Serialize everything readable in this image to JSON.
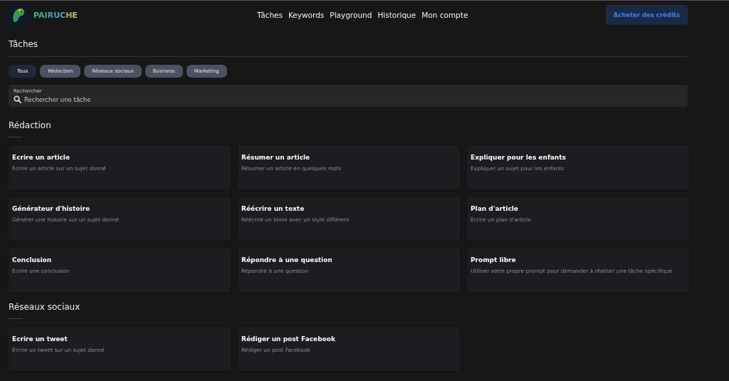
{
  "brand": "PAIRUCHE",
  "nav": [
    "Tâches",
    "Keywords",
    "Playground",
    "Historique",
    "Mon compte"
  ],
  "buy_button": "Acheter des crédits",
  "page_title": "Tâches",
  "filters": [
    {
      "label": "Tous",
      "selected": true
    },
    {
      "label": "Rédaction",
      "selected": false
    },
    {
      "label": "Réseaux sociaux",
      "selected": false
    },
    {
      "label": "Business",
      "selected": false
    },
    {
      "label": "Marketing",
      "selected": false
    }
  ],
  "search": {
    "label": "Rechercher",
    "placeholder": "Rechercher une tâche"
  },
  "sections": [
    {
      "title": "Rédaction",
      "tasks": [
        {
          "title": "Ecrire un article",
          "description": "Ecrire un article sur un sujet donné"
        },
        {
          "title": "Résumer un article",
          "description": "Résumer un article en quelques mots"
        },
        {
          "title": "Expliquer pour les enfants",
          "description": "Expliquer un sujet pour les enfants"
        },
        {
          "title": "Générateur d'histoire",
          "description": "Générer une histoire sur un sujet donné"
        },
        {
          "title": "Réécrire un texte",
          "description": "Réécrire un texte avec un style différent"
        },
        {
          "title": "Plan d'article",
          "description": "Ecrire un plan d'article"
        },
        {
          "title": "Conclusion",
          "description": "Ecrire une conclusion"
        },
        {
          "title": "Répondre à une question",
          "description": "Répondre à une question"
        },
        {
          "title": "Prompt libre",
          "description": "Utiliser votre propre prompt pour demander à réaliser une tâche spécifique"
        }
      ]
    },
    {
      "title": "Réseaux sociaux",
      "tasks": [
        {
          "title": "Ecrire un tweet",
          "description": "Ecrire un tweet sur un sujet donné"
        },
        {
          "title": "Rédiger un post Facebook",
          "description": "Rédiger un post Facebook"
        }
      ]
    }
  ]
}
